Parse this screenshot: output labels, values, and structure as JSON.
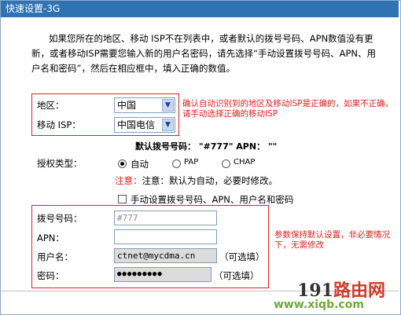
{
  "window": {
    "title": "快速设置-3G"
  },
  "intro": {
    "text": "如果您所在的地区、移动 ISP不在列表中，或者默认的拨号号码、APN数值没有更新，或者移动ISP需要您输入新的用户名密码，请先选择“手动设置拨号号码、APN、用户名和密码”，然后在相应框中，填入正确的数值。"
  },
  "region": {
    "label": "地区：",
    "value": "中国"
  },
  "isp": {
    "label": "移动 ISP：",
    "value": "中国电信"
  },
  "region_note": "确认自动识别到的地区及移动ISP是正确的，如果不正确，请手动选择正确的移动ISP",
  "default_dial": {
    "text": "默认拨号号码：  \"#777\"   APN：  \"\""
  },
  "auth": {
    "label": "授权类型：",
    "options": [
      "自动",
      "PAP",
      "CHAP"
    ],
    "selected": "自动",
    "note": "注意：默认为自动，必要时修改。"
  },
  "manual": {
    "label": "手动设置拨号号码、APN、用户名和密码",
    "checked": false
  },
  "fields": {
    "dial_label": "拨号号码：",
    "dial_value": "#777",
    "apn_label": "APN：",
    "apn_value": "",
    "user_label": "用户名：",
    "user_value": "ctnet@mycdma.cn",
    "user_optional": "（可选填）",
    "pass_label": "密码：",
    "pass_value": "●●●●●●●●●",
    "pass_optional": "（可选填）"
  },
  "params_note": "参数保持默认设置，非必要情况下，无需修改",
  "watermark": {
    "line1_a": "191",
    "line1_b": "路由网",
    "line2": "www.xiqb.com"
  },
  "colors": {
    "title_bg": "#2f73b3",
    "accent_red": "#e02020"
  }
}
